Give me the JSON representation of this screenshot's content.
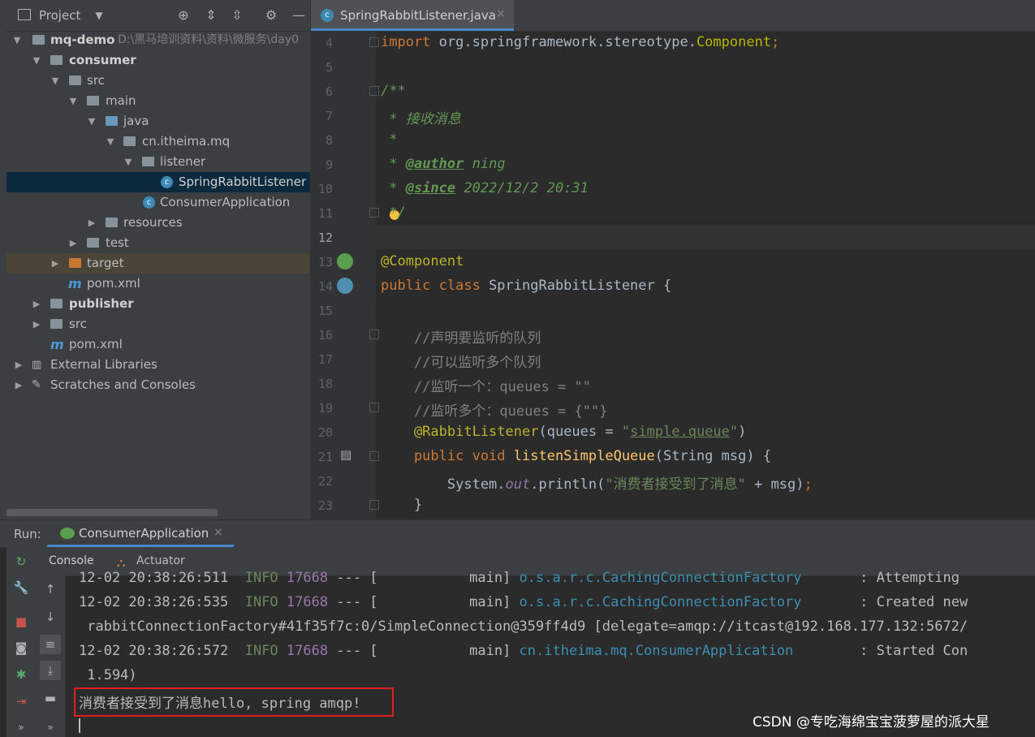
{
  "project_panel": {
    "title": "Project",
    "tree": [
      {
        "label": "mq-demo",
        "path": "D:\\黑马培训资料\\资料\\微服务\\day0",
        "bold": true
      },
      {
        "label": "consumer",
        "bold": true
      },
      {
        "label": "src"
      },
      {
        "label": "main"
      },
      {
        "label": "java"
      },
      {
        "label": "cn.itheima.mq"
      },
      {
        "label": "listener"
      },
      {
        "label": "SpringRabbitListener"
      },
      {
        "label": "ConsumerApplication"
      },
      {
        "label": "resources"
      },
      {
        "label": "test"
      },
      {
        "label": "target"
      },
      {
        "label": "pom.xml"
      },
      {
        "label": "publisher",
        "bold": true
      },
      {
        "label": "src"
      },
      {
        "label": "pom.xml"
      },
      {
        "label": "External Libraries"
      },
      {
        "label": "Scratches and Consoles"
      }
    ]
  },
  "editor": {
    "tab_label": "SpringRabbitListener.java",
    "tab_close": "×",
    "line_numbers": [
      "4",
      "5",
      "6",
      "7",
      "8",
      "9",
      "10",
      "11",
      "12",
      "13",
      "14",
      "15",
      "16",
      "17",
      "18",
      "19",
      "20",
      "21",
      "22",
      "23"
    ],
    "lines": {
      "l4_kw": "import",
      "l4_pkg": " org.springframework.stereotype.",
      "l4_cls": "Component",
      "l4_semi": ";",
      "l6": "/**",
      "l7": " * 接收消息",
      "l8": " *",
      "l9_pre": " * ",
      "l9_tag": "@author",
      "l9_val": " ning",
      "l10_pre": " * ",
      "l10_tag": "@since",
      "l10_val": " 2022/12/2 20:31",
      "l11": " */",
      "l13": "@Component",
      "l14_kw": "public class",
      "l14_rest": " SpringRabbitListener {",
      "l16": "    //声明要监听的队列",
      "l17": "    //可以监听多个队列",
      "l18": "    //监听一个：queues = \"\"",
      "l19": "    //监听多个：queues = {\"\"}",
      "l20_ann": "    @RabbitListener",
      "l20_mid": "(queues = ",
      "l20_q1": "\"",
      "l20_str": "simple.queue",
      "l20_q2": "\"",
      "l20_end": ")",
      "l21_kw": "    public void",
      "l21_fn": " listenSimpleQueue",
      "l21_rest": "(String msg) {",
      "l22_a": "        System.",
      "l22_out": "out",
      "l22_b": ".println(",
      "l22_str": "\"消费者接受到了消息\"",
      "l22_c": " + msg)",
      "l22_semi": ";",
      "l23": "    }"
    }
  },
  "run_panel": {
    "run_label": "Run:",
    "tab_label": "ConsumerApplication",
    "tab_close": "×",
    "subtab_console": "Console",
    "subtab_actuator": "Actuator",
    "console_lines": [
      {
        "ts": "12-02 20:38:26:511",
        "level": "INFO",
        "pid": "17668",
        "sep": " --- [",
        "thread": "           main]",
        "cls": " o.s.a.r.c.CachingConnectionFactory",
        "msg": "       : Attempting "
      },
      {
        "ts": "12-02 20:38:26:535",
        "level": "INFO",
        "pid": "17668",
        "sep": " --- [",
        "thread": "           main]",
        "cls": " o.s.a.r.c.CachingConnectionFactory",
        "msg": "       : Created new"
      },
      {
        "text": " rabbitConnectionFactory#41f35f7c:0/SimpleConnection@359ff4d9 [delegate=amqp://itcast@192.168.177.132:5672/"
      },
      {
        "ts": "12-02 20:38:26:572",
        "level": "INFO",
        "pid": "17668",
        "sep": " --- [",
        "thread": "           main]",
        "cls": " cn.itheima.mq.ConsumerApplication",
        "msg": "        : Started Con"
      },
      {
        "text": " 1.594)"
      },
      {
        "text": "消费者接受到了消息hello, spring amqp!"
      }
    ]
  },
  "watermark": "CSDN @专吃海绵宝宝菠萝屋的派大星",
  "colors": {
    "accent": "#4a88c7",
    "highlight_box": "#e0201f",
    "selection": "#0d293e"
  }
}
